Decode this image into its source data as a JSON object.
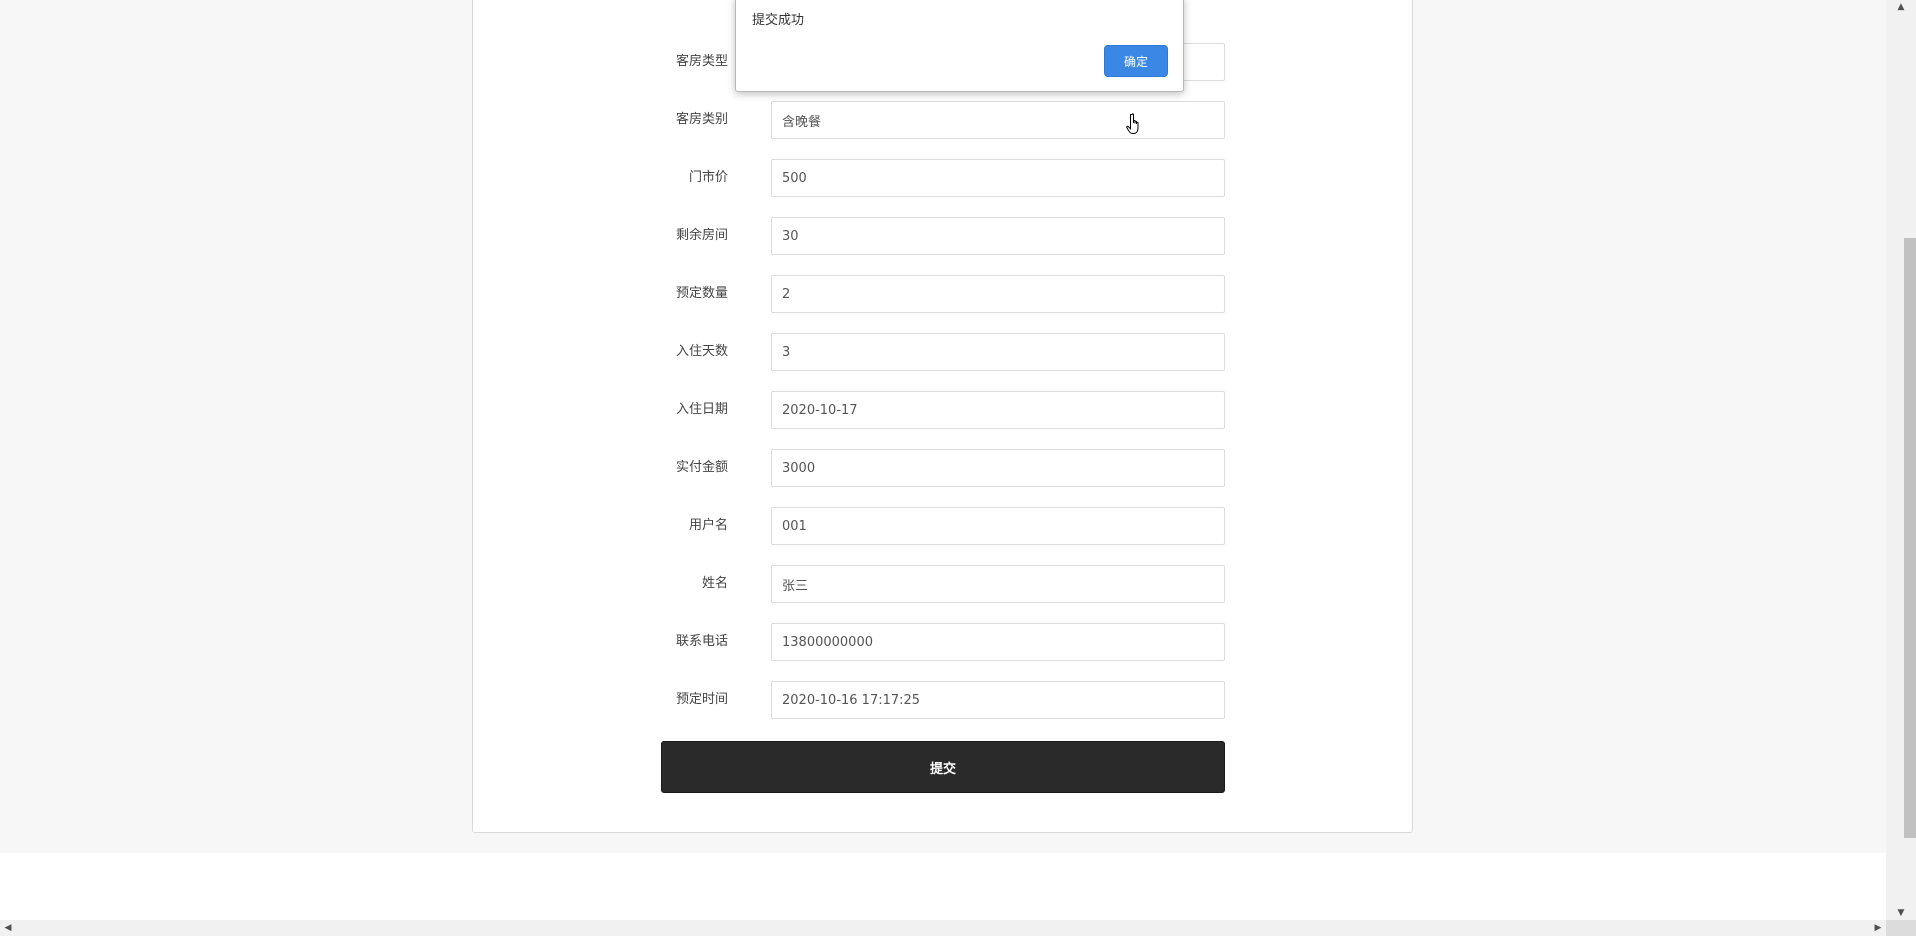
{
  "form": {
    "fields": [
      {
        "label": "客房类型",
        "value": ""
      },
      {
        "label": "客房类别",
        "value": "含晚餐"
      },
      {
        "label": "门市价",
        "value": "500"
      },
      {
        "label": "剩余房间",
        "value": "30"
      },
      {
        "label": "预定数量",
        "value": "2"
      },
      {
        "label": "入住天数",
        "value": "3"
      },
      {
        "label": "入住日期",
        "value": "2020-10-17"
      },
      {
        "label": "实付金额",
        "value": "3000"
      },
      {
        "label": "用户名",
        "value": "001"
      },
      {
        "label": "姓名",
        "value": "张三"
      },
      {
        "label": "联系电话",
        "value": "13800000000"
      },
      {
        "label": "预定时间",
        "value": "2020-10-16 17:17:25"
      }
    ],
    "submit_label": "提交"
  },
  "alert": {
    "message": "提交成功",
    "ok_label": "确定"
  },
  "scrollbars": {
    "up_arrow": "▲",
    "down_arrow": "▼",
    "left_arrow": "◀",
    "right_arrow": "▶"
  },
  "colors": {
    "submit_bg": "#2a2a2a",
    "alert_ok_bg": "#3b87e6",
    "page_bg": "#f7f7f7"
  },
  "icons": {
    "cursor": "hand-pointer-icon"
  }
}
